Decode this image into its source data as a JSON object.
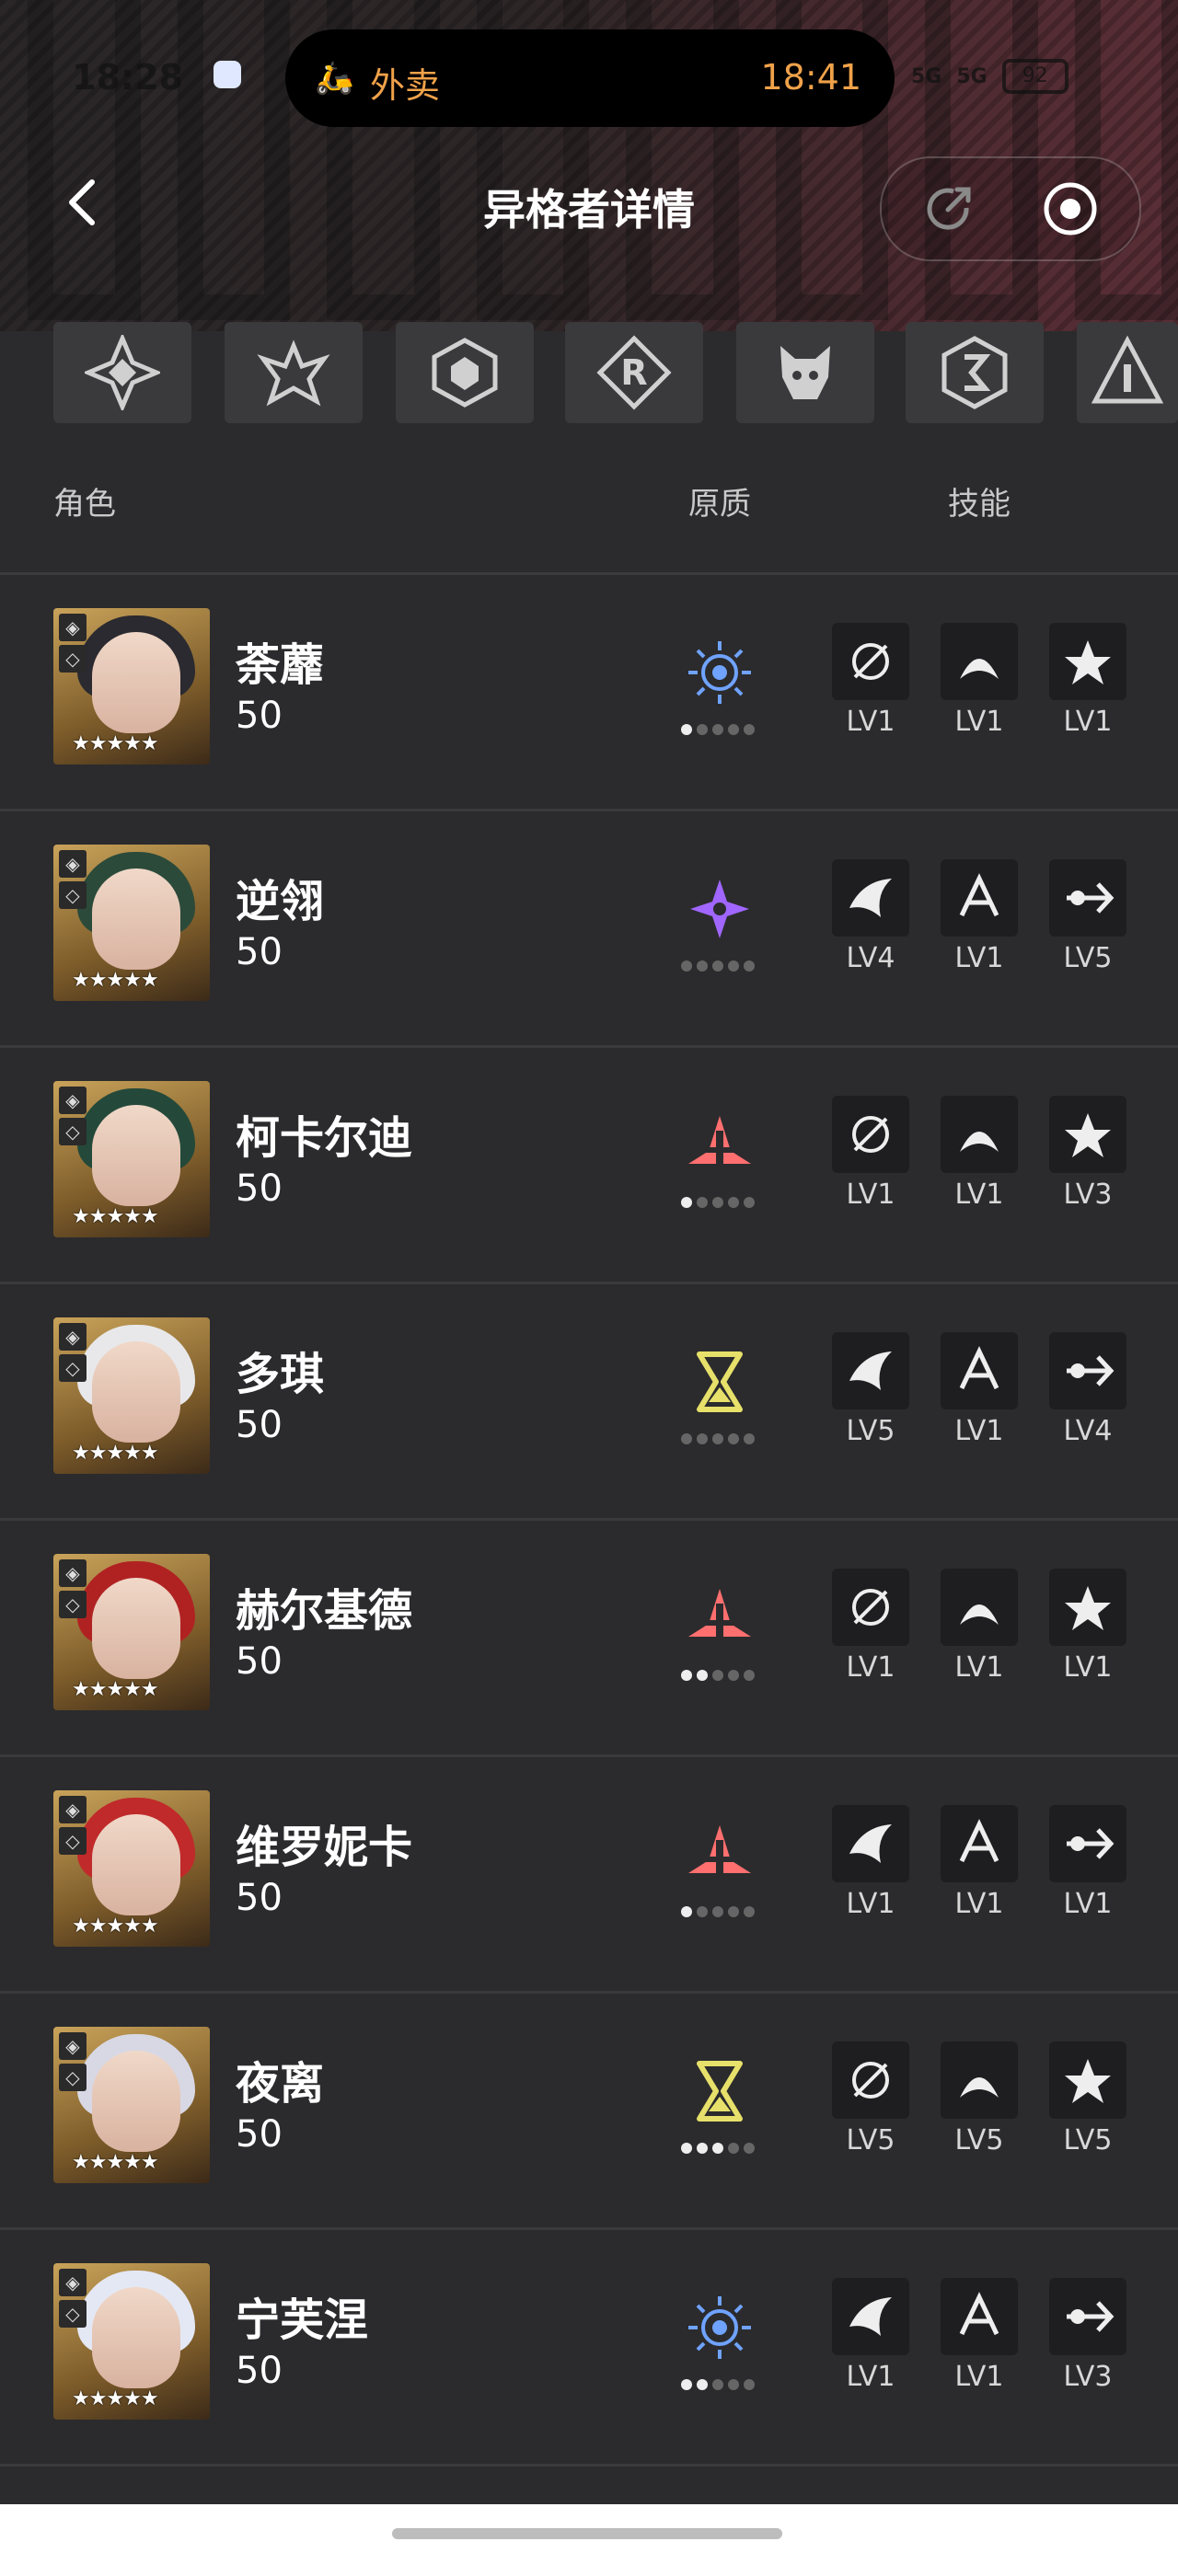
{
  "status_bar": {
    "time": "18:28",
    "pill_label": "外卖",
    "pill_time": "18:41",
    "network": "5G",
    "battery": "92"
  },
  "nav": {
    "title": "异格者详情",
    "back_icon": "chevron-left-icon",
    "share_icon": "share-icon",
    "record_icon": "record-icon"
  },
  "factions": [
    "faction-1-icon",
    "faction-2-icon",
    "faction-3-icon",
    "faction-4-icon",
    "faction-5-icon",
    "faction-6-icon",
    "faction-7-icon"
  ],
  "columns": {
    "role": "角色",
    "nature": "原质",
    "skill": "技能"
  },
  "characters": [
    {
      "name": "荼蘼",
      "level": "50",
      "attr_color": "#6fa3ff",
      "attr_icon": "eye-sun-icon",
      "dots": 1,
      "hair": "#2a2a30",
      "skills": [
        "LV1",
        "LV1",
        "LV1"
      ]
    },
    {
      "name": "逆翎",
      "level": "50",
      "attr_color": "#a066ff",
      "attr_icon": "shuriken-icon",
      "dots": 0,
      "hair": "#2b4a3a",
      "skills": [
        "LV4",
        "LV1",
        "LV5"
      ]
    },
    {
      "name": "柯卡尔迪",
      "level": "50",
      "attr_color": "#ff6f6f",
      "attr_icon": "spike-icon",
      "dots": 1,
      "hair": "#24493a",
      "skills": [
        "LV1",
        "LV1",
        "LV3"
      ]
    },
    {
      "name": "多琪",
      "level": "50",
      "attr_color": "#e7e06a",
      "attr_icon": "hourglass-icon",
      "dots": 0,
      "hair": "#e8e8ea",
      "skills": [
        "LV5",
        "LV1",
        "LV4"
      ]
    },
    {
      "name": "赫尔基德",
      "level": "50",
      "attr_color": "#ff6f6f",
      "attr_icon": "spike-icon",
      "dots": 2,
      "hair": "#b02222",
      "skills": [
        "LV1",
        "LV1",
        "LV1"
      ]
    },
    {
      "name": "维罗妮卡",
      "level": "50",
      "attr_color": "#ff6f6f",
      "attr_icon": "spike-icon",
      "dots": 1,
      "hair": "#c02a2a",
      "skills": [
        "LV1",
        "LV1",
        "LV1"
      ]
    },
    {
      "name": "夜离",
      "level": "50",
      "attr_color": "#e7e06a",
      "attr_icon": "hourglass-icon",
      "dots": 3,
      "hair": "#d8d8e4",
      "skills": [
        "LV5",
        "LV5",
        "LV5"
      ]
    },
    {
      "name": "宁芙涅",
      "level": "50",
      "attr_color": "#6fa3ff",
      "attr_icon": "eye-sun-icon",
      "dots": 2,
      "hair": "#e4e8f4",
      "skills": [
        "LV1",
        "LV1",
        "LV3"
      ]
    }
  ],
  "star_text": "★★★★★"
}
